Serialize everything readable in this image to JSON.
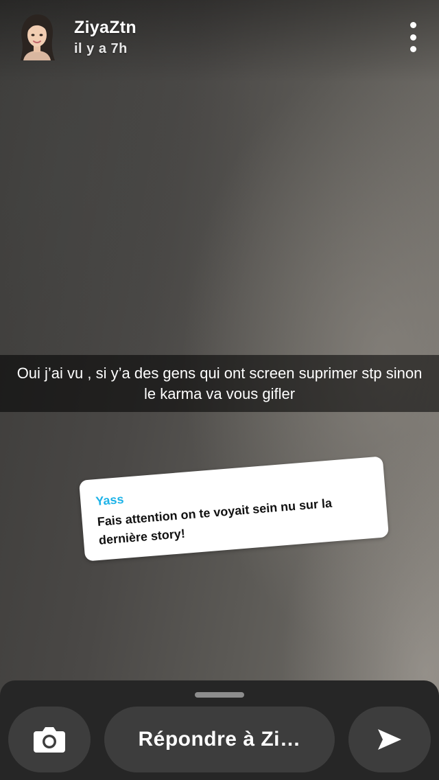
{
  "header": {
    "username": "ZiyaZtn",
    "time_ago": "il y a 7h",
    "avatar_icon": "bitmoji-avatar-icon",
    "more_icon": "more-vertical-icon"
  },
  "story": {
    "caption": "Oui j’ai vu , si y’a des gens qui ont screen suprimer stp sinon le karma va vous gifler"
  },
  "reply_sticker": {
    "name": "Yass",
    "message": "Fais attention on te voyait sein nu sur la dernière story!",
    "name_color": "#1eb3e8"
  },
  "bottom_bar": {
    "camera_icon": "camera-icon",
    "reply_placeholder": "Répondre à Zi…",
    "send_icon": "send-arrow-icon"
  }
}
